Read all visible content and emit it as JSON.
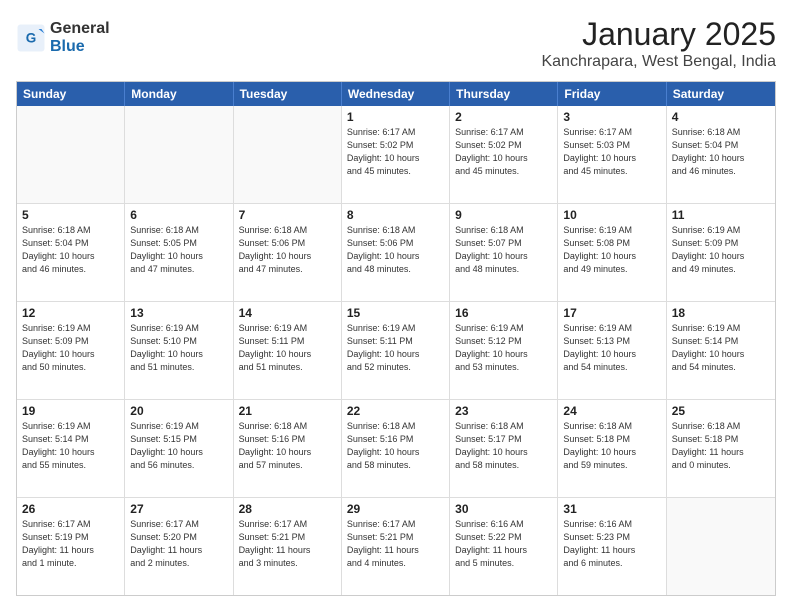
{
  "logo": {
    "general": "General",
    "blue": "Blue"
  },
  "title": "January 2025",
  "subtitle": "Kanchrapara, West Bengal, India",
  "header_days": [
    "Sunday",
    "Monday",
    "Tuesday",
    "Wednesday",
    "Thursday",
    "Friday",
    "Saturday"
  ],
  "weeks": [
    [
      {
        "day": "",
        "info": ""
      },
      {
        "day": "",
        "info": ""
      },
      {
        "day": "",
        "info": ""
      },
      {
        "day": "1",
        "info": "Sunrise: 6:17 AM\nSunset: 5:02 PM\nDaylight: 10 hours\nand 45 minutes."
      },
      {
        "day": "2",
        "info": "Sunrise: 6:17 AM\nSunset: 5:02 PM\nDaylight: 10 hours\nand 45 minutes."
      },
      {
        "day": "3",
        "info": "Sunrise: 6:17 AM\nSunset: 5:03 PM\nDaylight: 10 hours\nand 45 minutes."
      },
      {
        "day": "4",
        "info": "Sunrise: 6:18 AM\nSunset: 5:04 PM\nDaylight: 10 hours\nand 46 minutes."
      }
    ],
    [
      {
        "day": "5",
        "info": "Sunrise: 6:18 AM\nSunset: 5:04 PM\nDaylight: 10 hours\nand 46 minutes."
      },
      {
        "day": "6",
        "info": "Sunrise: 6:18 AM\nSunset: 5:05 PM\nDaylight: 10 hours\nand 47 minutes."
      },
      {
        "day": "7",
        "info": "Sunrise: 6:18 AM\nSunset: 5:06 PM\nDaylight: 10 hours\nand 47 minutes."
      },
      {
        "day": "8",
        "info": "Sunrise: 6:18 AM\nSunset: 5:06 PM\nDaylight: 10 hours\nand 48 minutes."
      },
      {
        "day": "9",
        "info": "Sunrise: 6:18 AM\nSunset: 5:07 PM\nDaylight: 10 hours\nand 48 minutes."
      },
      {
        "day": "10",
        "info": "Sunrise: 6:19 AM\nSunset: 5:08 PM\nDaylight: 10 hours\nand 49 minutes."
      },
      {
        "day": "11",
        "info": "Sunrise: 6:19 AM\nSunset: 5:09 PM\nDaylight: 10 hours\nand 49 minutes."
      }
    ],
    [
      {
        "day": "12",
        "info": "Sunrise: 6:19 AM\nSunset: 5:09 PM\nDaylight: 10 hours\nand 50 minutes."
      },
      {
        "day": "13",
        "info": "Sunrise: 6:19 AM\nSunset: 5:10 PM\nDaylight: 10 hours\nand 51 minutes."
      },
      {
        "day": "14",
        "info": "Sunrise: 6:19 AM\nSunset: 5:11 PM\nDaylight: 10 hours\nand 51 minutes."
      },
      {
        "day": "15",
        "info": "Sunrise: 6:19 AM\nSunset: 5:11 PM\nDaylight: 10 hours\nand 52 minutes."
      },
      {
        "day": "16",
        "info": "Sunrise: 6:19 AM\nSunset: 5:12 PM\nDaylight: 10 hours\nand 53 minutes."
      },
      {
        "day": "17",
        "info": "Sunrise: 6:19 AM\nSunset: 5:13 PM\nDaylight: 10 hours\nand 54 minutes."
      },
      {
        "day": "18",
        "info": "Sunrise: 6:19 AM\nSunset: 5:14 PM\nDaylight: 10 hours\nand 54 minutes."
      }
    ],
    [
      {
        "day": "19",
        "info": "Sunrise: 6:19 AM\nSunset: 5:14 PM\nDaylight: 10 hours\nand 55 minutes."
      },
      {
        "day": "20",
        "info": "Sunrise: 6:19 AM\nSunset: 5:15 PM\nDaylight: 10 hours\nand 56 minutes."
      },
      {
        "day": "21",
        "info": "Sunrise: 6:18 AM\nSunset: 5:16 PM\nDaylight: 10 hours\nand 57 minutes."
      },
      {
        "day": "22",
        "info": "Sunrise: 6:18 AM\nSunset: 5:16 PM\nDaylight: 10 hours\nand 58 minutes."
      },
      {
        "day": "23",
        "info": "Sunrise: 6:18 AM\nSunset: 5:17 PM\nDaylight: 10 hours\nand 58 minutes."
      },
      {
        "day": "24",
        "info": "Sunrise: 6:18 AM\nSunset: 5:18 PM\nDaylight: 10 hours\nand 59 minutes."
      },
      {
        "day": "25",
        "info": "Sunrise: 6:18 AM\nSunset: 5:18 PM\nDaylight: 11 hours\nand 0 minutes."
      }
    ],
    [
      {
        "day": "26",
        "info": "Sunrise: 6:17 AM\nSunset: 5:19 PM\nDaylight: 11 hours\nand 1 minute."
      },
      {
        "day": "27",
        "info": "Sunrise: 6:17 AM\nSunset: 5:20 PM\nDaylight: 11 hours\nand 2 minutes."
      },
      {
        "day": "28",
        "info": "Sunrise: 6:17 AM\nSunset: 5:21 PM\nDaylight: 11 hours\nand 3 minutes."
      },
      {
        "day": "29",
        "info": "Sunrise: 6:17 AM\nSunset: 5:21 PM\nDaylight: 11 hours\nand 4 minutes."
      },
      {
        "day": "30",
        "info": "Sunrise: 6:16 AM\nSunset: 5:22 PM\nDaylight: 11 hours\nand 5 minutes."
      },
      {
        "day": "31",
        "info": "Sunrise: 6:16 AM\nSunset: 5:23 PM\nDaylight: 11 hours\nand 6 minutes."
      },
      {
        "day": "",
        "info": ""
      }
    ]
  ]
}
